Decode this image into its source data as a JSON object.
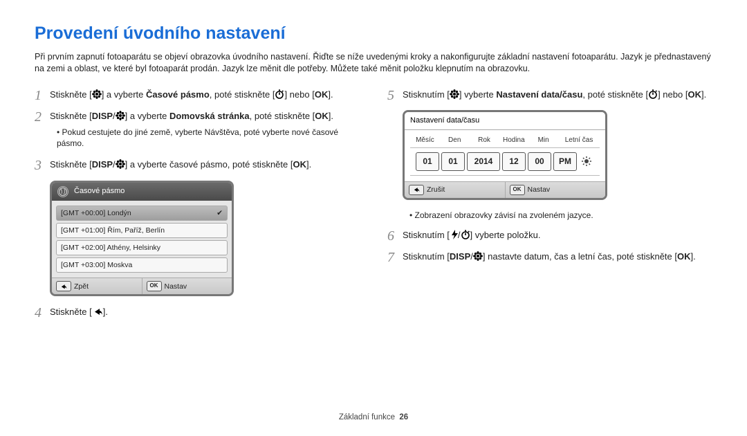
{
  "title": "Provedení úvodního nastavení",
  "intro": "Při prvním zapnutí fotoaparátu se objeví obrazovka úvodního nastavení. Řiďte se níže uvedenými kroky a nakonfigurujte základní nastavení fotoaparátu. Jazyk je přednastavený na zemi a oblast, ve které byl fotoaparát prodán. Jazyk lze měnit dle potřeby. Můžete také měnit položku klepnutím na obrazovku.",
  "steps": {
    "s1a": "Stiskněte [",
    "s1b": "] a vyberte ",
    "s1bold": "Časové pásmo",
    "s1c": ", poté stiskněte [",
    "s1d": "] nebo [",
    "s1e": "].",
    "s2a": "Stiskněte [",
    "s2mid": "/",
    "s2b": "] a vyberte ",
    "s2bold": "Domovská stránka",
    "s2c": ", poté stiskněte [",
    "s2d": "].",
    "s2bullet": "Pokud cestujete do jiné země, vyberte Návštěva, poté vyberte nové časové pásmo.",
    "s3a": "Stiskněte [",
    "s3b": "] a vyberte časové pásmo, poté stiskněte [",
    "s3c": "].",
    "s4a": "Stiskněte [",
    "s4b": "].",
    "s5a": "Stisknutím [",
    "s5b": "] vyberte ",
    "s5bold": "Nastavení data/času",
    "s5c": ", poté stiskněte [",
    "s5d": "] nebo [",
    "s5e": "].",
    "s5bullet": "Zobrazení obrazovky závisí na zvoleném jazyce.",
    "s6a": "Stisknutím [",
    "s6mid": "/",
    "s6b": "] vyberte položku.",
    "s7a": "Stisknutím [",
    "s7b": "] nastavte datum, čas a letní čas, poté stiskněte [",
    "s7c": "]."
  },
  "tz_device": {
    "title": "Časové pásmo",
    "items": [
      "[GMT +00:00] Londýn",
      "[GMT +01:00] Řím, Paříž, Berlín",
      "[GMT +02:00] Athény, Helsinky",
      "[GMT +03:00] Moskva"
    ],
    "back": "Zpět",
    "set": "Nastav",
    "ok": "OK"
  },
  "dt_device": {
    "title": "Nastavení data/času",
    "labels": {
      "month": "Měsíc",
      "day": "Den",
      "year": "Rok",
      "hour": "Hodina",
      "min": "Min",
      "dst": "Letní čas"
    },
    "vals": {
      "month": "01",
      "day": "01",
      "year": "2014",
      "hour": "12",
      "min": "00",
      "ampm": "PM"
    },
    "cancel": "Zrušit",
    "set": "Nastav",
    "ok": "OK"
  },
  "footer": {
    "section": "Základní funkce",
    "page": "26"
  }
}
